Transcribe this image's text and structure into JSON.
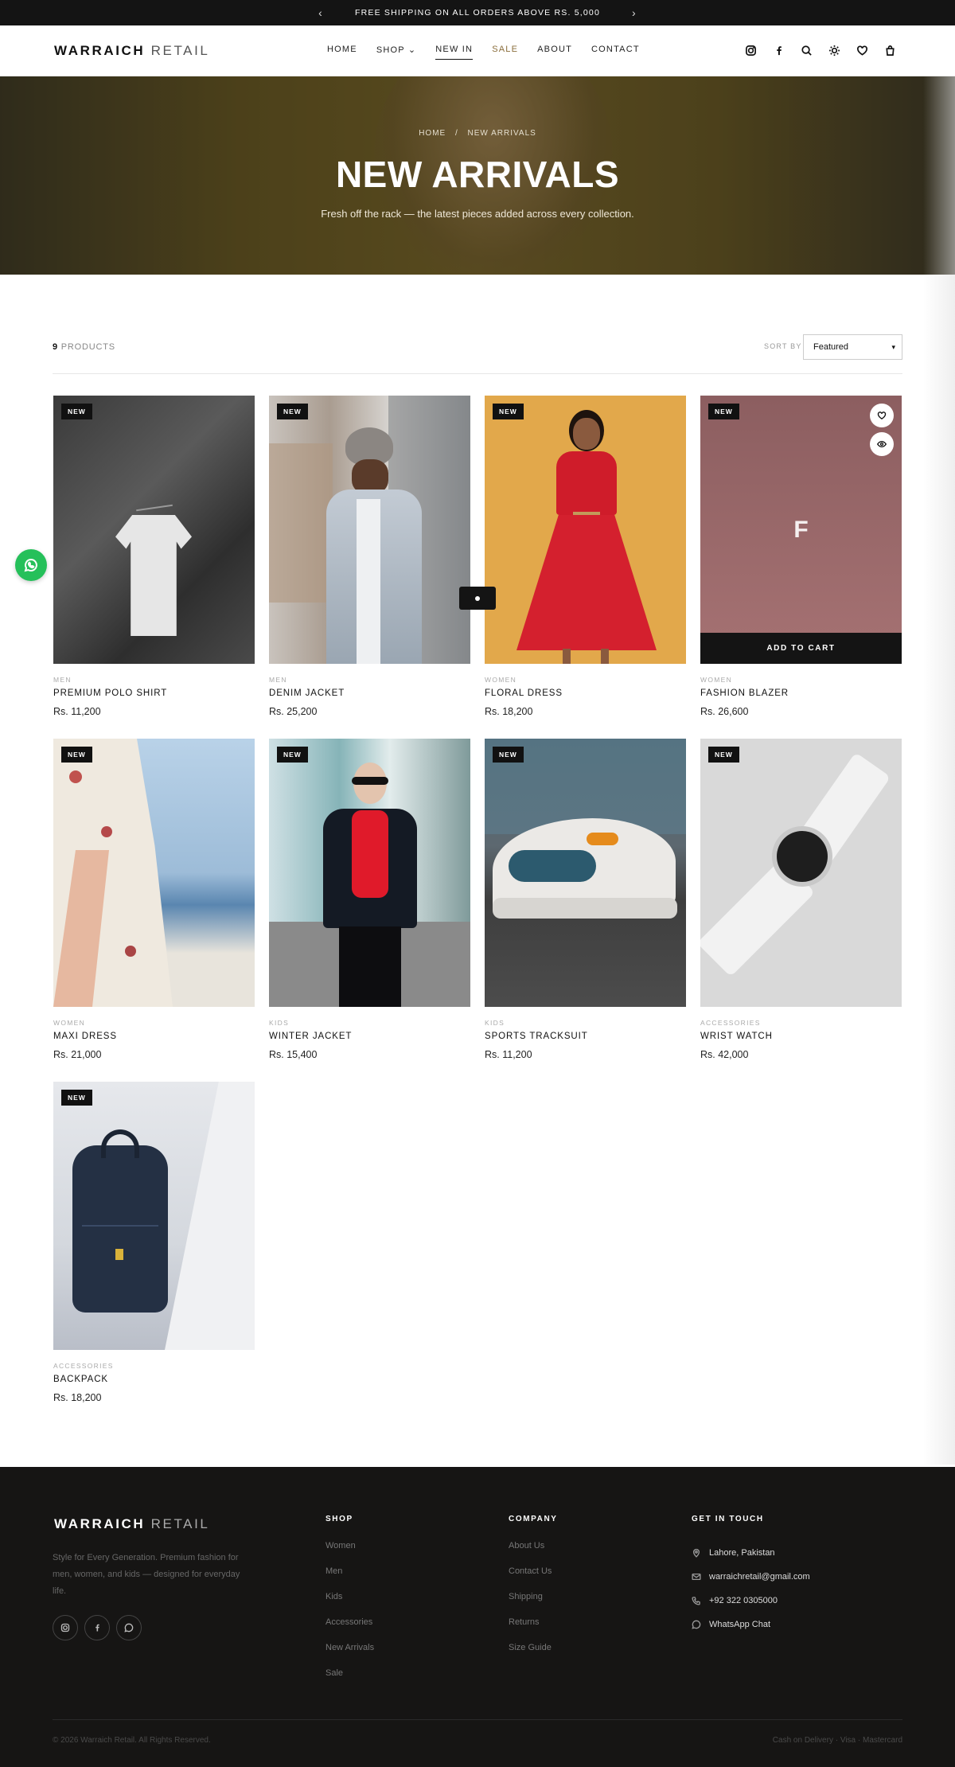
{
  "announcement": {
    "text": "FREE SHIPPING ON ALL ORDERS ABOVE RS. 5,000",
    "prev": "‹",
    "next": "›"
  },
  "header": {
    "logo_bold": "WARRAICH",
    "logo_light": "RETAIL",
    "nav": [
      {
        "label": "HOME"
      },
      {
        "label": "SHOP ⌄"
      },
      {
        "label": "NEW IN"
      },
      {
        "label": "SALE"
      },
      {
        "label": "ABOUT"
      },
      {
        "label": "CONTACT"
      }
    ],
    "icons": [
      "instagram-icon",
      "facebook-icon",
      "search-icon",
      "theme-toggle-icon",
      "wishlist-icon",
      "cart-icon"
    ]
  },
  "hero": {
    "breadcrumb_home": "HOME",
    "breadcrumb_sep": "/",
    "breadcrumb_current": "NEW ARRIVALS",
    "title": "NEW ARRIVALS",
    "subtitle": "Fresh off the rack — the latest pieces added across every collection."
  },
  "toolbar": {
    "count_number": "9",
    "count_label": "PRODUCTS",
    "sort_label": "SORT BY",
    "sort_value": "Featured"
  },
  "products": [
    {
      "badge": "NEW",
      "category": "MEN",
      "name": "PREMIUM POLO SHIRT",
      "price": "Rs. 11,200"
    },
    {
      "badge": "NEW",
      "category": "MEN",
      "name": "DENIM JACKET",
      "price": "Rs. 25,200"
    },
    {
      "badge": "NEW",
      "category": "WOMEN",
      "name": "FLORAL DRESS",
      "price": "Rs. 18,200"
    },
    {
      "badge": "NEW",
      "category": "WOMEN",
      "name": "FASHION BLAZER",
      "price": "Rs. 26,600",
      "placeholder_letter": "F",
      "add_to_cart": "ADD TO CART"
    },
    {
      "badge": "NEW",
      "category": "WOMEN",
      "name": "MAXI DRESS",
      "price": "Rs. 21,000"
    },
    {
      "badge": "NEW",
      "category": "KIDS",
      "name": "WINTER JACKET",
      "price": "Rs. 15,400"
    },
    {
      "badge": "NEW",
      "category": "KIDS",
      "name": "SPORTS TRACKSUIT",
      "price": "Rs. 11,200"
    },
    {
      "badge": "NEW",
      "category": "ACCESSORIES",
      "name": "WRIST WATCH",
      "price": "Rs. 42,000"
    },
    {
      "badge": "NEW",
      "category": "ACCESSORIES",
      "name": "BACKPACK",
      "price": "Rs. 18,200"
    }
  ],
  "footer": {
    "logo_bold": "WARRAICH",
    "logo_light": "RETAIL",
    "description": "Style for Every Generation. Premium fashion for men, women, and kids — designed for everyday life.",
    "shop_heading": "SHOP",
    "shop_links": [
      "Women",
      "Men",
      "Kids",
      "Accessories",
      "New Arrivals",
      "Sale"
    ],
    "company_heading": "COMPANY",
    "company_links": [
      "About Us",
      "Contact Us",
      "Shipping",
      "Returns",
      "Size Guide"
    ],
    "contact_heading": "GET IN TOUCH",
    "contact": {
      "location": "Lahore, Pakistan",
      "email": "warraichretail@gmail.com",
      "phone": "+92 322 0305000",
      "whatsapp": "WhatsApp Chat"
    },
    "copyright": "© 2026 Warraich Retail. All Rights Reserved.",
    "payments": "Cash on Delivery · Visa · Mastercard"
  },
  "colors": {
    "accent_dark": "#141414",
    "sale": "#8a6d3b",
    "whatsapp": "#25c05a",
    "blazer_placeholder": "#9b6a6c"
  }
}
